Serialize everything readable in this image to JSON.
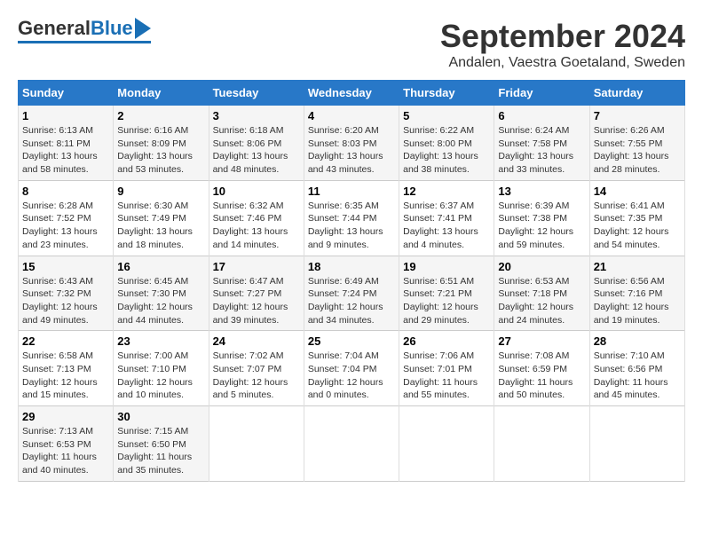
{
  "logo": {
    "text_general": "General",
    "text_blue": "Blue"
  },
  "title": "September 2024",
  "subtitle": "Andalen, Vaestra Goetaland, Sweden",
  "days_of_week": [
    "Sunday",
    "Monday",
    "Tuesday",
    "Wednesday",
    "Thursday",
    "Friday",
    "Saturday"
  ],
  "weeks": [
    [
      {
        "day": "1",
        "sunrise": "6:13 AM",
        "sunset": "8:11 PM",
        "daylight": "13 hours and 58 minutes."
      },
      {
        "day": "2",
        "sunrise": "6:16 AM",
        "sunset": "8:09 PM",
        "daylight": "13 hours and 53 minutes."
      },
      {
        "day": "3",
        "sunrise": "6:18 AM",
        "sunset": "8:06 PM",
        "daylight": "13 hours and 48 minutes."
      },
      {
        "day": "4",
        "sunrise": "6:20 AM",
        "sunset": "8:03 PM",
        "daylight": "13 hours and 43 minutes."
      },
      {
        "day": "5",
        "sunrise": "6:22 AM",
        "sunset": "8:00 PM",
        "daylight": "13 hours and 38 minutes."
      },
      {
        "day": "6",
        "sunrise": "6:24 AM",
        "sunset": "7:58 PM",
        "daylight": "13 hours and 33 minutes."
      },
      {
        "day": "7",
        "sunrise": "6:26 AM",
        "sunset": "7:55 PM",
        "daylight": "13 hours and 28 minutes."
      }
    ],
    [
      {
        "day": "8",
        "sunrise": "6:28 AM",
        "sunset": "7:52 PM",
        "daylight": "13 hours and 23 minutes."
      },
      {
        "day": "9",
        "sunrise": "6:30 AM",
        "sunset": "7:49 PM",
        "daylight": "13 hours and 18 minutes."
      },
      {
        "day": "10",
        "sunrise": "6:32 AM",
        "sunset": "7:46 PM",
        "daylight": "13 hours and 14 minutes."
      },
      {
        "day": "11",
        "sunrise": "6:35 AM",
        "sunset": "7:44 PM",
        "daylight": "13 hours and 9 minutes."
      },
      {
        "day": "12",
        "sunrise": "6:37 AM",
        "sunset": "7:41 PM",
        "daylight": "13 hours and 4 minutes."
      },
      {
        "day": "13",
        "sunrise": "6:39 AM",
        "sunset": "7:38 PM",
        "daylight": "12 hours and 59 minutes."
      },
      {
        "day": "14",
        "sunrise": "6:41 AM",
        "sunset": "7:35 PM",
        "daylight": "12 hours and 54 minutes."
      }
    ],
    [
      {
        "day": "15",
        "sunrise": "6:43 AM",
        "sunset": "7:32 PM",
        "daylight": "12 hours and 49 minutes."
      },
      {
        "day": "16",
        "sunrise": "6:45 AM",
        "sunset": "7:30 PM",
        "daylight": "12 hours and 44 minutes."
      },
      {
        "day": "17",
        "sunrise": "6:47 AM",
        "sunset": "7:27 PM",
        "daylight": "12 hours and 39 minutes."
      },
      {
        "day": "18",
        "sunrise": "6:49 AM",
        "sunset": "7:24 PM",
        "daylight": "12 hours and 34 minutes."
      },
      {
        "day": "19",
        "sunrise": "6:51 AM",
        "sunset": "7:21 PM",
        "daylight": "12 hours and 29 minutes."
      },
      {
        "day": "20",
        "sunrise": "6:53 AM",
        "sunset": "7:18 PM",
        "daylight": "12 hours and 24 minutes."
      },
      {
        "day": "21",
        "sunrise": "6:56 AM",
        "sunset": "7:16 PM",
        "daylight": "12 hours and 19 minutes."
      }
    ],
    [
      {
        "day": "22",
        "sunrise": "6:58 AM",
        "sunset": "7:13 PM",
        "daylight": "12 hours and 15 minutes."
      },
      {
        "day": "23",
        "sunrise": "7:00 AM",
        "sunset": "7:10 PM",
        "daylight": "12 hours and 10 minutes."
      },
      {
        "day": "24",
        "sunrise": "7:02 AM",
        "sunset": "7:07 PM",
        "daylight": "12 hours and 5 minutes."
      },
      {
        "day": "25",
        "sunrise": "7:04 AM",
        "sunset": "7:04 PM",
        "daylight": "12 hours and 0 minutes."
      },
      {
        "day": "26",
        "sunrise": "7:06 AM",
        "sunset": "7:01 PM",
        "daylight": "11 hours and 55 minutes."
      },
      {
        "day": "27",
        "sunrise": "7:08 AM",
        "sunset": "6:59 PM",
        "daylight": "11 hours and 50 minutes."
      },
      {
        "day": "28",
        "sunrise": "7:10 AM",
        "sunset": "6:56 PM",
        "daylight": "11 hours and 45 minutes."
      }
    ],
    [
      {
        "day": "29",
        "sunrise": "7:13 AM",
        "sunset": "6:53 PM",
        "daylight": "11 hours and 40 minutes."
      },
      {
        "day": "30",
        "sunrise": "7:15 AM",
        "sunset": "6:50 PM",
        "daylight": "11 hours and 35 minutes."
      },
      null,
      null,
      null,
      null,
      null
    ]
  ]
}
